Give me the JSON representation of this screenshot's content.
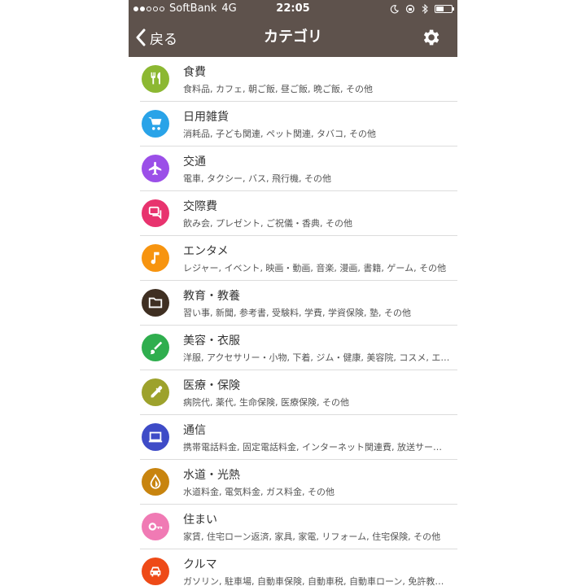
{
  "status_bar": {
    "carrier": "SoftBank",
    "network": "4G",
    "time": "22:05"
  },
  "nav": {
    "back_label": "戻る",
    "title": "カテゴリ"
  },
  "categories": [
    {
      "title": "食費",
      "subtitle": "食料品, カフェ, 朝ご飯, 昼ご飯, 晩ご飯, その他",
      "color": "#8cb832",
      "icon": "utensils-icon"
    },
    {
      "title": "日用雑貨",
      "subtitle": "消耗品, 子ども関連, ペット関連, タバコ, その他",
      "color": "#29a3e8",
      "icon": "shopping-cart-icon"
    },
    {
      "title": "交通",
      "subtitle": "電車, タクシー, バス, 飛行機, その他",
      "color": "#9b4fe8",
      "icon": "airplane-icon"
    },
    {
      "title": "交際費",
      "subtitle": "飲み会, プレゼント, ご祝儀・香典, その他",
      "color": "#e8336e",
      "icon": "chat-icon"
    },
    {
      "title": "エンタメ",
      "subtitle": "レジャー, イベント, 映画・動画, 音楽, 漫画, 書籍, ゲーム, その他",
      "color": "#f7940f",
      "icon": "music-note-icon"
    },
    {
      "title": "教育・教養",
      "subtitle": "習い事, 新聞, 参考書, 受験料, 学費, 学資保険, 塾, その他",
      "color": "#3f2f22",
      "icon": "folder-icon"
    },
    {
      "title": "美容・衣服",
      "subtitle": "洋服, アクセサリー・小物, 下着, ジム・健康, 美容院, コスメ, エ…",
      "color": "#2fae4e",
      "icon": "brush-icon"
    },
    {
      "title": "医療・保険",
      "subtitle": "病院代, 薬代, 生命保険, 医療保険, その他",
      "color": "#9da22c",
      "icon": "dropper-icon"
    },
    {
      "title": "通信",
      "subtitle": "携帯電話料金, 固定電話料金, インターネット関連費, 放送サー…",
      "color": "#3e4bc7",
      "icon": "laptop-icon"
    },
    {
      "title": "水道・光熱",
      "subtitle": "水道料金, 電気料金, ガス料金, その他",
      "color": "#c8840f",
      "icon": "water-drop-icon"
    },
    {
      "title": "住まい",
      "subtitle": "家賃, 住宅ローン返済, 家具, 家電, リフォーム, 住宅保険, その他",
      "color": "#f07ab4",
      "icon": "key-icon"
    },
    {
      "title": "クルマ",
      "subtitle": "ガソリン, 駐車場, 自動車保険, 自動車税, 自動車ローン, 免許教…",
      "color": "#ee4a17",
      "icon": "car-icon"
    }
  ],
  "colors": {
    "nav_bg": "#5e524c"
  }
}
